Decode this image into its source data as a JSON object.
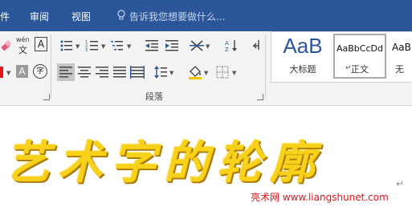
{
  "menu": {
    "item1": "件",
    "item2": "审阅",
    "item3": "视图",
    "tell_me": "告诉我您想要做什么..."
  },
  "ribbon": {
    "phonetic_label": "wén",
    "phonetic_char": "文",
    "char_border_label": "A",
    "shading_a": "A",
    "enclose_char": "字",
    "paragraph_group_label": "段落"
  },
  "styles": [
    {
      "preview": "AaB",
      "name": "大标题"
    },
    {
      "preview": "AaBbCcDd",
      "name": "正文"
    },
    {
      "preview": "AaB",
      "name": "无"
    }
  ],
  "document": {
    "art_text": "艺术字的轮廓",
    "watermark": "亮术网 www.liangshunet.com"
  },
  "colors": {
    "ribbon_blue": "#2b579a",
    "accent_red": "#e4141b",
    "art_gold": "#f7d11a"
  }
}
